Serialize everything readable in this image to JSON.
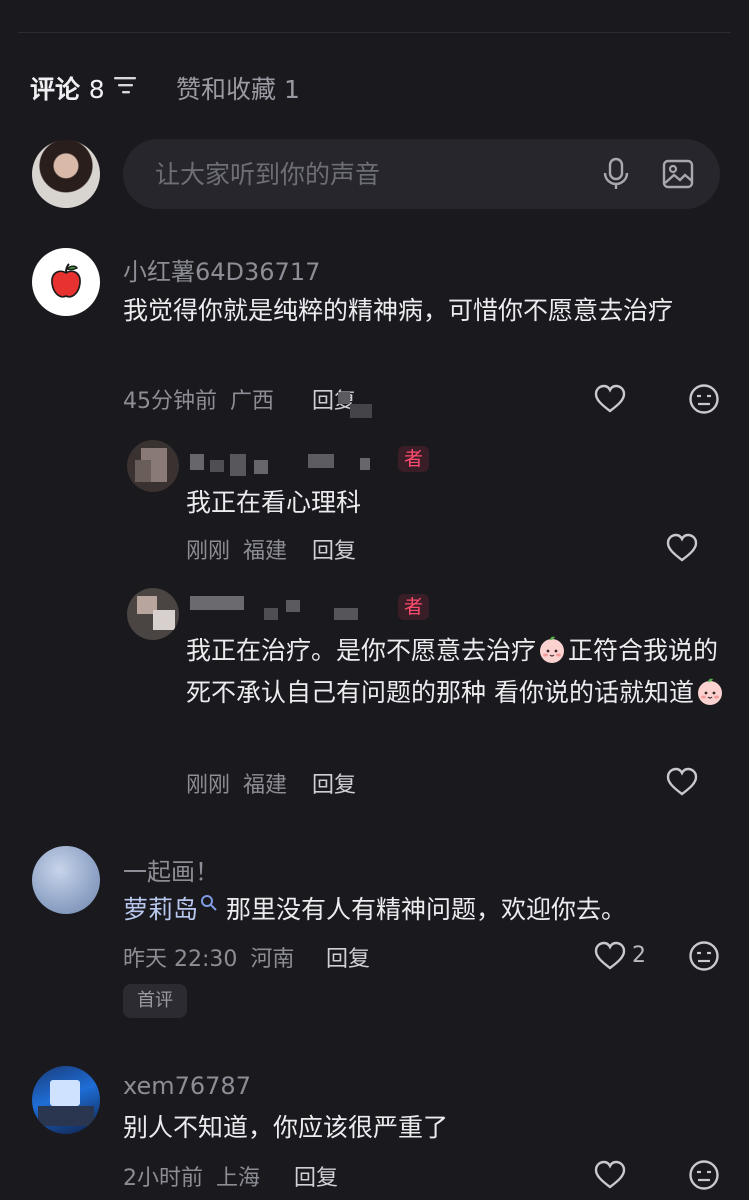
{
  "tabs": {
    "comments_label": "评论",
    "comments_count": "8",
    "likes_label": "赞和收藏 1"
  },
  "input": {
    "placeholder": "让大家听到你的声音"
  },
  "comments": [
    {
      "user": "小红薯64D36717",
      "text": "我觉得你就是纯粹的精神病，可惜你不愿意去治疗",
      "time": "45分钟前",
      "location": "广西",
      "reply_label": "回复",
      "replies": [
        {
          "text": "我正在看心理科",
          "time": "刚刚",
          "location": "福建",
          "reply_label": "回复",
          "badge": "者"
        },
        {
          "text_1": "我正在治疗。是你不愿意去治疗",
          "text_2": "正符合我说的 死不承认自己有问题的那种 看你说的话就知道",
          "time": "刚刚",
          "location": "福建",
          "reply_label": "回复",
          "badge": "者"
        }
      ]
    },
    {
      "user": "一起画！",
      "mention": "萝莉岛",
      "text": "那里没有人有精神问题，欢迎你去。",
      "time": "昨天 22:30",
      "location": "河南",
      "reply_label": "回复",
      "likes": "2",
      "tag": "首评"
    },
    {
      "user": "xem76787",
      "text": "别人不知道，你应该很严重了",
      "time": "2小时前",
      "location": "上海",
      "reply_label": "回复"
    }
  ],
  "colors": {
    "background": "#19191e",
    "author_badge": "#ff4b6e",
    "apple": "#e8322f"
  }
}
